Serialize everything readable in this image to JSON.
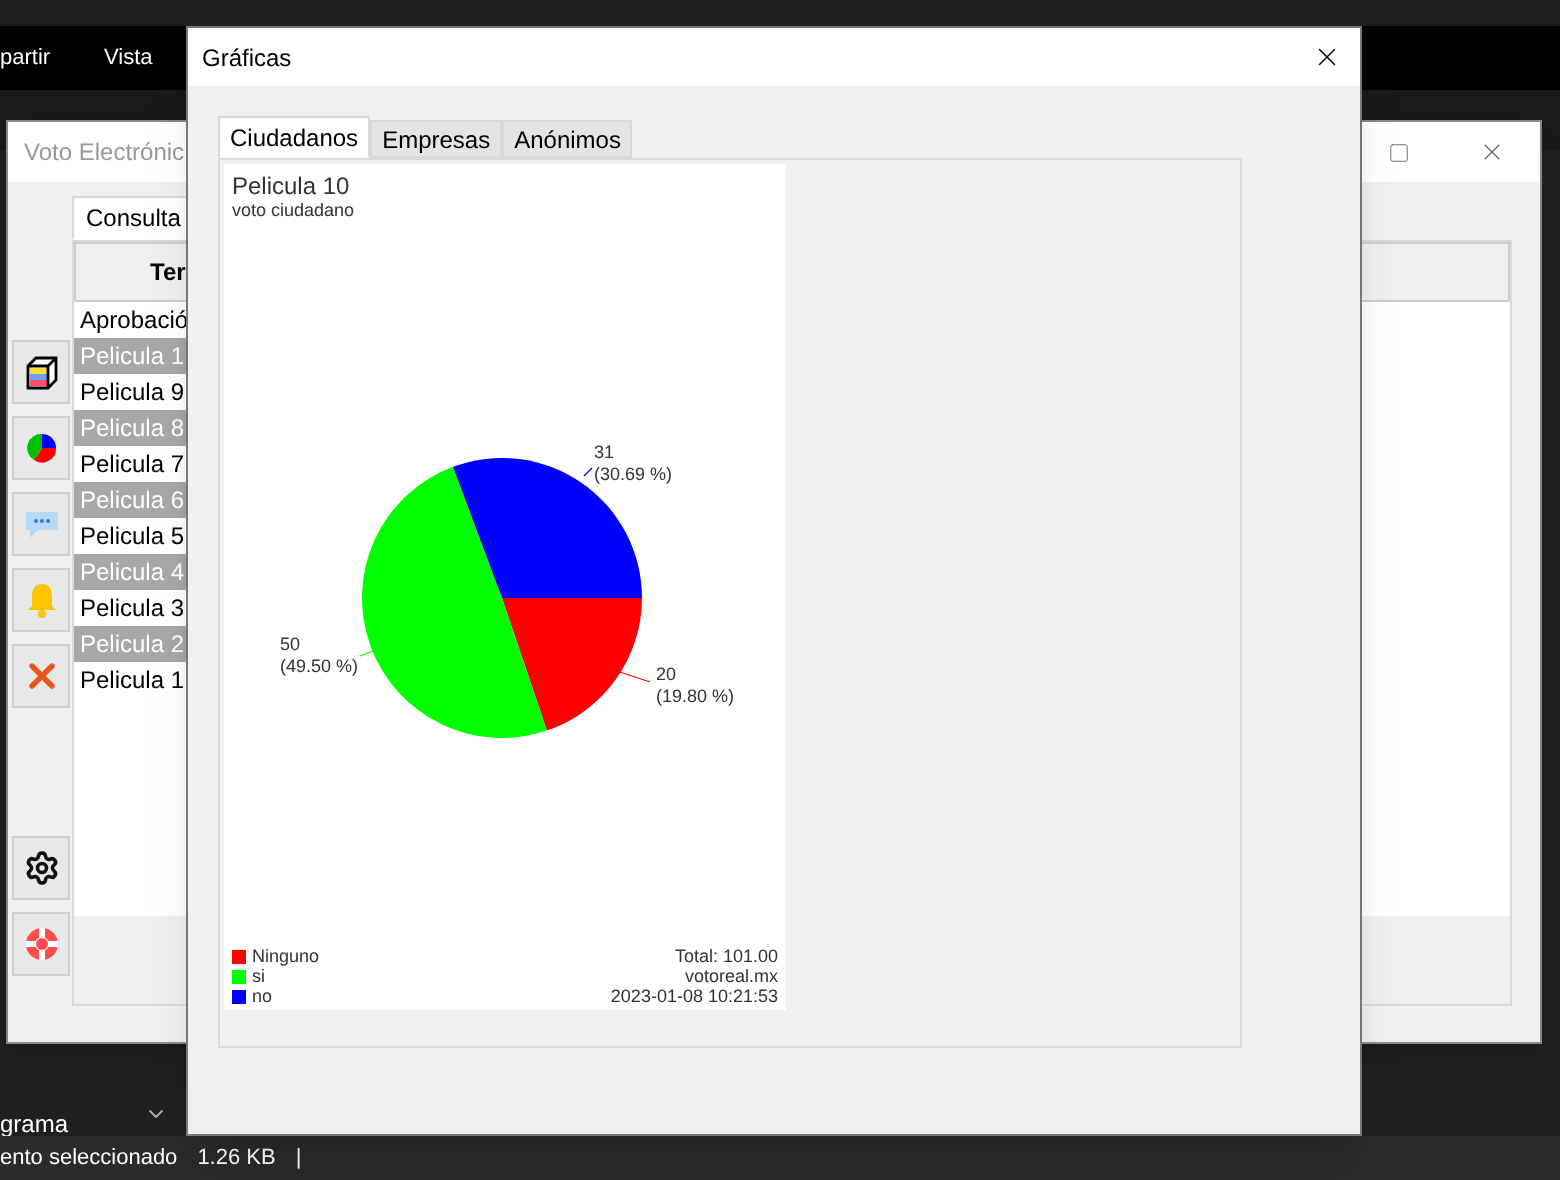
{
  "explorer": {
    "menu": [
      "partir",
      "Vista"
    ],
    "nav_label": "grama",
    "status": {
      "selection": "ento seleccionado",
      "size": "1.26 KB",
      "separator": "|"
    }
  },
  "main_window": {
    "title": "Voto Electrónic",
    "tabs": [
      {
        "label": "Consulta",
        "selected": true
      }
    ],
    "table": {
      "columns": [
        "Ter"
      ],
      "rows": [
        {
          "cell": "Aprobació",
          "selected": false
        },
        {
          "cell": "Pelicula 1",
          "selected": true
        },
        {
          "cell": "Pelicula 9",
          "selected": false
        },
        {
          "cell": "Pelicula 8",
          "selected": true
        },
        {
          "cell": "Pelicula 7",
          "selected": false
        },
        {
          "cell": "Pelicula 6",
          "selected": true
        },
        {
          "cell": "Pelicula 5",
          "selected": false
        },
        {
          "cell": "Pelicula 4",
          "selected": true
        },
        {
          "cell": "Pelicula 3",
          "selected": false
        },
        {
          "cell": "Pelicula 2",
          "selected": true
        },
        {
          "cell": "Pelicula 1",
          "selected": false
        }
      ]
    },
    "toolbar": [
      {
        "kind": "cube"
      },
      {
        "kind": "pie"
      },
      {
        "kind": "chat"
      },
      {
        "kind": "bell"
      },
      {
        "kind": "delete"
      },
      {
        "kind": "gap"
      },
      {
        "kind": "settings"
      },
      {
        "kind": "help"
      }
    ]
  },
  "dialog": {
    "title": "Gráficas",
    "tabs": [
      {
        "label": "Ciudadanos",
        "selected": true
      },
      {
        "label": "Empresas",
        "selected": false
      },
      {
        "label": "Anónimos",
        "selected": false
      }
    ],
    "chart": {
      "title": "Pelicula 10",
      "subtitle": "voto ciudadano",
      "legend": [
        {
          "label": "Ninguno",
          "color": "#ff0000"
        },
        {
          "label": "si",
          "color": "#00ff00"
        },
        {
          "label": "no",
          "color": "#0000ff"
        }
      ],
      "footer": [
        "Total: 101.00",
        "votoreal.mx",
        "2023-01-08 10:21:53"
      ],
      "chart_data": {
        "type": "pie",
        "values": [
          20,
          50,
          31
        ],
        "value_labels": [
          "20\n(19.80 %)",
          "50\n(49.50 %)",
          "31\n(30.69 %)"
        ]
      }
    }
  }
}
